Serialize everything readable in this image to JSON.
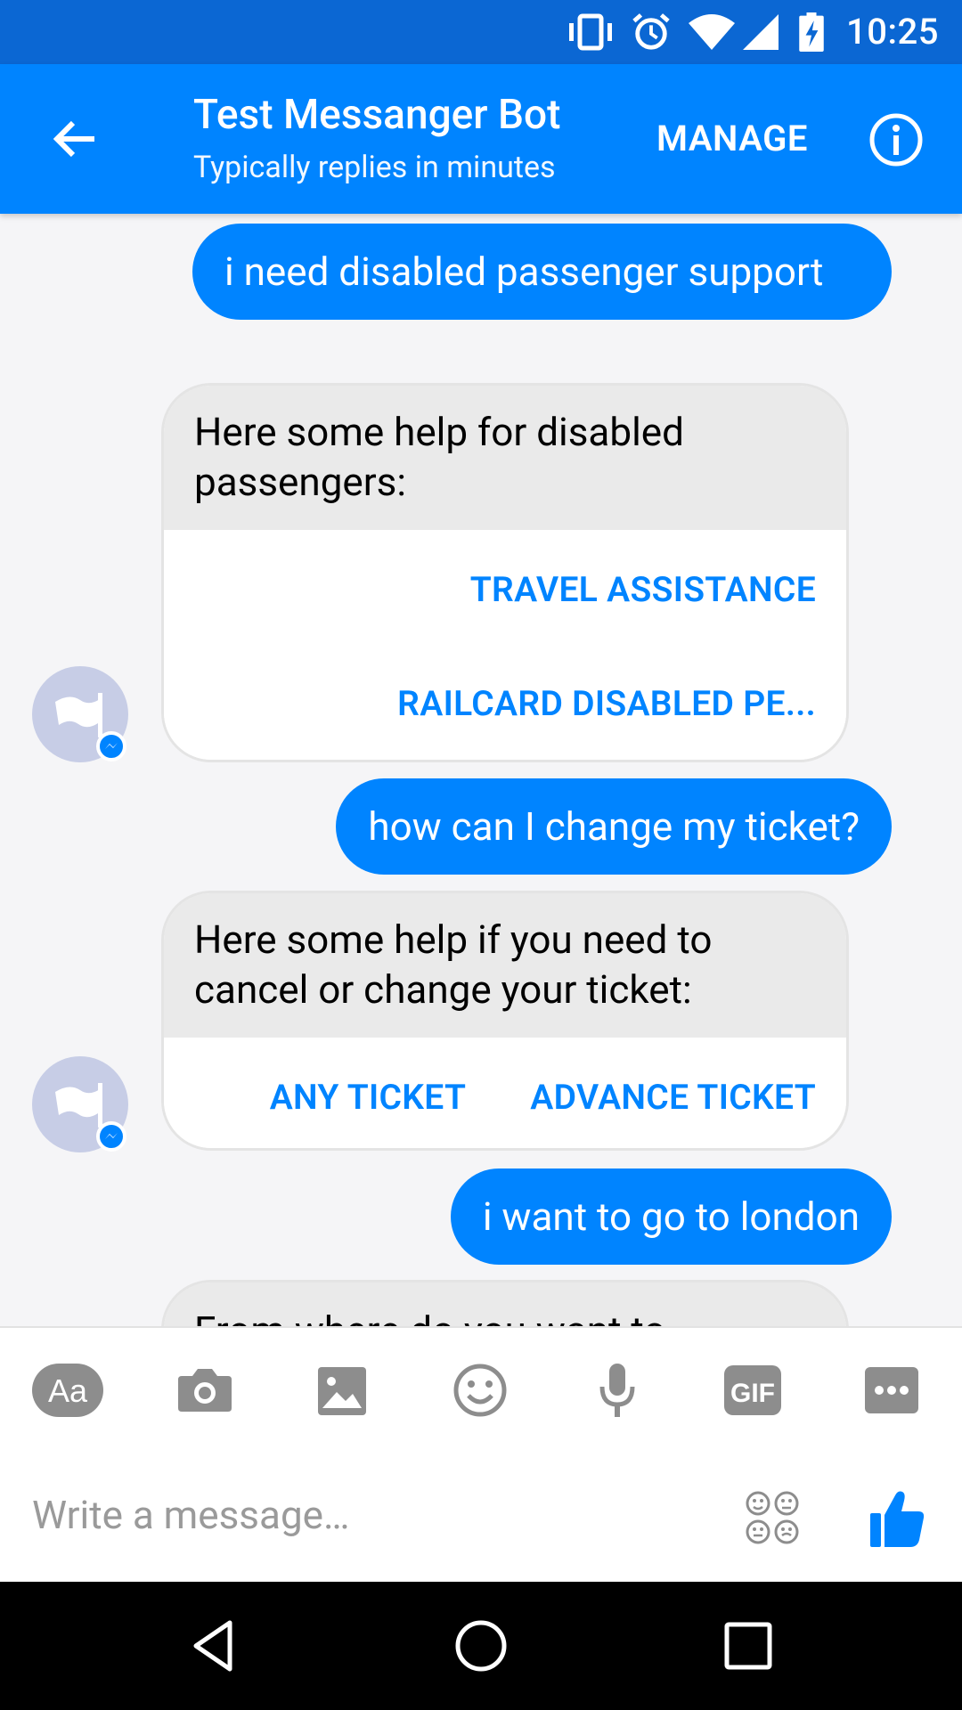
{
  "status_bar": {
    "time": "10:25"
  },
  "header": {
    "title": "Test Messanger Bot",
    "subtitle": "Typically replies in minutes",
    "manage_label": "MANAGE"
  },
  "messages": [
    {
      "type": "outgoing",
      "text": "i need disabled passenger support"
    },
    {
      "type": "card",
      "text": "Here some help for disabled passengers:",
      "buttons": [
        "TRAVEL ASSISTANCE",
        "RAILCARD DISABLED PE..."
      ]
    },
    {
      "type": "outgoing",
      "text": "how can I change my ticket?"
    },
    {
      "type": "card",
      "text": "Here some help if you need to cancel or change your ticket:",
      "buttons": [
        "ANY TICKET",
        "ADVANCE TICKET"
      ]
    },
    {
      "type": "outgoing",
      "text": "i want to go to london"
    },
    {
      "type": "card",
      "text": "From where do you want to",
      "buttons": []
    }
  ],
  "composer": {
    "toolbar": [
      "aa-icon",
      "camera-icon",
      "gallery-icon",
      "emoji-icon",
      "microphone-icon",
      "gif-icon",
      "more-icon"
    ],
    "placeholder": "Write a message…"
  },
  "colors": {
    "accent": "#0084ff",
    "status_bar": "#0b67d3"
  }
}
